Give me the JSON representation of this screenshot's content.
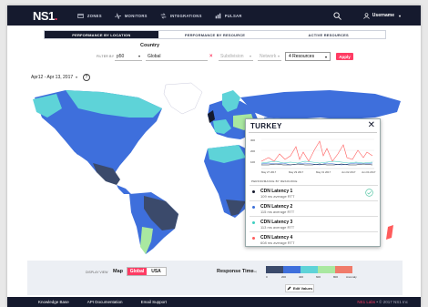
{
  "nav": {
    "logo": "NS1",
    "logo_dot": ".",
    "items": [
      {
        "label": "ZONES",
        "icon": "zones-icon"
      },
      {
        "label": "MONITORS",
        "icon": "monitors-icon"
      },
      {
        "label": "INTEGRATIONS",
        "icon": "integrations-icon"
      },
      {
        "label": "PULSAR",
        "icon": "pulsar-icon"
      }
    ],
    "username": "Username",
    "caret": "▾"
  },
  "tabs": [
    {
      "label": "PERFORMANCE BY LOCATION",
      "active": true
    },
    {
      "label": "PERFORMANCE BY RESOURCE",
      "active": false
    },
    {
      "label": "ACTIVE RESOURCES",
      "active": false
    }
  ],
  "filters": {
    "filter_by_label": "FILTER BY",
    "metric": "p50",
    "country_label": "Country",
    "country": "Global",
    "remove_symbol": "×",
    "subdivision": "Subdivision",
    "network": "Network",
    "resources": "4 Resources",
    "apply": "Apply",
    "caret": "▾"
  },
  "date_range": {
    "label": "Apr12 - Apr 13, 2017",
    "caret": "▾",
    "help": "?"
  },
  "popup": {
    "title": "TURKEY",
    "close": "✕",
    "y_ticks": [
      "300",
      "200",
      "100"
    ],
    "x_ticks": [
      "May 27 2017",
      "May 29 2017",
      "May 31 2017",
      "Jun 02 2017",
      "Jun 04 2017"
    ],
    "legend_title": "PERFORMANCE BY RESOURCE",
    "resources": [
      {
        "name": "CDN Latency 1",
        "sub": "109 ms average RTT",
        "color": "#151a2e",
        "checked": true
      },
      {
        "name": "CDN Latency 2",
        "sub": "115 ms average RTT",
        "color": "#3c6fd8",
        "checked": false
      },
      {
        "name": "CDN Latency  3",
        "sub": "113 ms average RTT",
        "color": "#3ecfc0",
        "checked": false
      },
      {
        "name": "CDN Latency 4",
        "sub": "608 ms average RTT",
        "color": "#ff5c5c",
        "checked": false
      }
    ]
  },
  "bottom": {
    "display_label": "DISPLAY VIEW",
    "map_label": "Map",
    "global": "Global",
    "usa": "USA",
    "response_time_label": "Response Time",
    "response_unit": "(ms)",
    "scale_colors": [
      "#3b4a6b",
      "#3e6fdc",
      "#5ed3d8",
      "#a9e8a0",
      "#f07b6a"
    ],
    "scale_ticks": [
      "0",
      "200",
      "400",
      "600",
      "800",
      "Anomaly"
    ],
    "edit_values": "Edit Values"
  },
  "footer": {
    "links": [
      "Knowledge Base",
      "API Documentation",
      "Email Support"
    ],
    "brand": "NS1 Labs",
    "copyright": " • © 2017 NS1 Inc"
  }
}
